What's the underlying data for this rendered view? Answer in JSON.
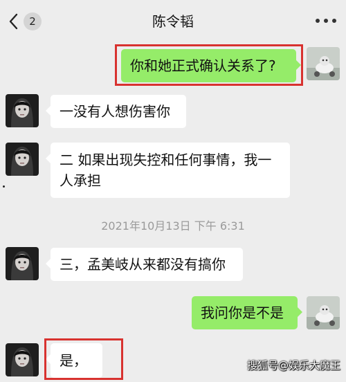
{
  "header": {
    "back_count": "2",
    "title": "陈令韬"
  },
  "messages": [
    {
      "side": "right",
      "text": "你和她正式确认关系了?"
    },
    {
      "side": "left",
      "text": "一没有人想伤害你"
    },
    {
      "side": "left",
      "line1": "二 如果出现失控和任何事情，我一",
      "line2": "人承担"
    },
    {
      "side": "left",
      "text": "三，孟美岐从来都没有搞你"
    },
    {
      "side": "right",
      "text": "我问你是不是"
    },
    {
      "side": "left",
      "text": "是，"
    }
  ],
  "timestamp": "2021年10月13日 下午 6:31",
  "watermark": "搜狐号@娱乐大魔王",
  "colors": {
    "background": "#ededed",
    "bubble_right": "#95ec69",
    "bubble_left": "#ffffff",
    "highlight_box": "#d8322f"
  },
  "icons": {
    "back": "chevron-left-icon",
    "more": "more-dots-icon"
  }
}
